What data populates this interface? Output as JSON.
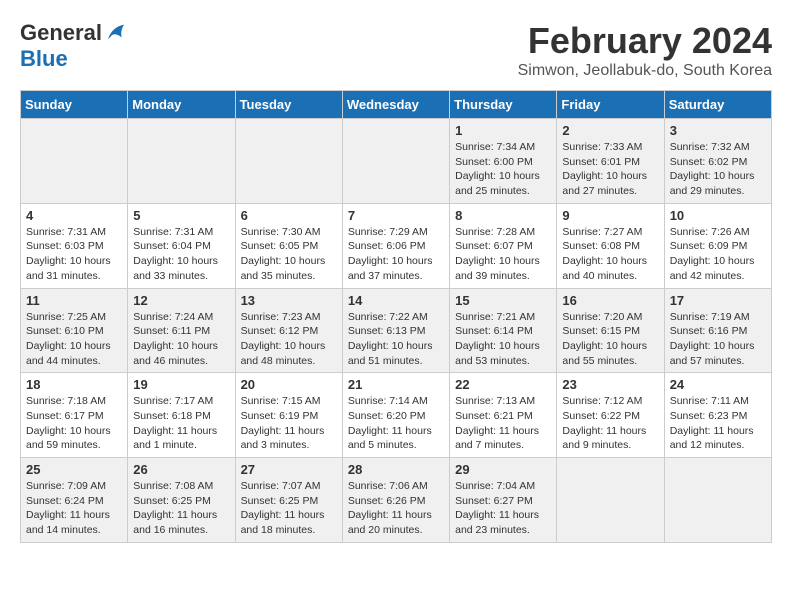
{
  "logo": {
    "general": "General",
    "blue": "Blue"
  },
  "title": "February 2024",
  "location": "Simwon, Jeollabuk-do, South Korea",
  "weekdays": [
    "Sunday",
    "Monday",
    "Tuesday",
    "Wednesday",
    "Thursday",
    "Friday",
    "Saturday"
  ],
  "weeks": [
    [
      {
        "day": "",
        "info": ""
      },
      {
        "day": "",
        "info": ""
      },
      {
        "day": "",
        "info": ""
      },
      {
        "day": "",
        "info": ""
      },
      {
        "day": "1",
        "info": "Sunrise: 7:34 AM\nSunset: 6:00 PM\nDaylight: 10 hours\nand 25 minutes."
      },
      {
        "day": "2",
        "info": "Sunrise: 7:33 AM\nSunset: 6:01 PM\nDaylight: 10 hours\nand 27 minutes."
      },
      {
        "day": "3",
        "info": "Sunrise: 7:32 AM\nSunset: 6:02 PM\nDaylight: 10 hours\nand 29 minutes."
      }
    ],
    [
      {
        "day": "4",
        "info": "Sunrise: 7:31 AM\nSunset: 6:03 PM\nDaylight: 10 hours\nand 31 minutes."
      },
      {
        "day": "5",
        "info": "Sunrise: 7:31 AM\nSunset: 6:04 PM\nDaylight: 10 hours\nand 33 minutes."
      },
      {
        "day": "6",
        "info": "Sunrise: 7:30 AM\nSunset: 6:05 PM\nDaylight: 10 hours\nand 35 minutes."
      },
      {
        "day": "7",
        "info": "Sunrise: 7:29 AM\nSunset: 6:06 PM\nDaylight: 10 hours\nand 37 minutes."
      },
      {
        "day": "8",
        "info": "Sunrise: 7:28 AM\nSunset: 6:07 PM\nDaylight: 10 hours\nand 39 minutes."
      },
      {
        "day": "9",
        "info": "Sunrise: 7:27 AM\nSunset: 6:08 PM\nDaylight: 10 hours\nand 40 minutes."
      },
      {
        "day": "10",
        "info": "Sunrise: 7:26 AM\nSunset: 6:09 PM\nDaylight: 10 hours\nand 42 minutes."
      }
    ],
    [
      {
        "day": "11",
        "info": "Sunrise: 7:25 AM\nSunset: 6:10 PM\nDaylight: 10 hours\nand 44 minutes."
      },
      {
        "day": "12",
        "info": "Sunrise: 7:24 AM\nSunset: 6:11 PM\nDaylight: 10 hours\nand 46 minutes."
      },
      {
        "day": "13",
        "info": "Sunrise: 7:23 AM\nSunset: 6:12 PM\nDaylight: 10 hours\nand 48 minutes."
      },
      {
        "day": "14",
        "info": "Sunrise: 7:22 AM\nSunset: 6:13 PM\nDaylight: 10 hours\nand 51 minutes."
      },
      {
        "day": "15",
        "info": "Sunrise: 7:21 AM\nSunset: 6:14 PM\nDaylight: 10 hours\nand 53 minutes."
      },
      {
        "day": "16",
        "info": "Sunrise: 7:20 AM\nSunset: 6:15 PM\nDaylight: 10 hours\nand 55 minutes."
      },
      {
        "day": "17",
        "info": "Sunrise: 7:19 AM\nSunset: 6:16 PM\nDaylight: 10 hours\nand 57 minutes."
      }
    ],
    [
      {
        "day": "18",
        "info": "Sunrise: 7:18 AM\nSunset: 6:17 PM\nDaylight: 10 hours\nand 59 minutes."
      },
      {
        "day": "19",
        "info": "Sunrise: 7:17 AM\nSunset: 6:18 PM\nDaylight: 11 hours\nand 1 minute."
      },
      {
        "day": "20",
        "info": "Sunrise: 7:15 AM\nSunset: 6:19 PM\nDaylight: 11 hours\nand 3 minutes."
      },
      {
        "day": "21",
        "info": "Sunrise: 7:14 AM\nSunset: 6:20 PM\nDaylight: 11 hours\nand 5 minutes."
      },
      {
        "day": "22",
        "info": "Sunrise: 7:13 AM\nSunset: 6:21 PM\nDaylight: 11 hours\nand 7 minutes."
      },
      {
        "day": "23",
        "info": "Sunrise: 7:12 AM\nSunset: 6:22 PM\nDaylight: 11 hours\nand 9 minutes."
      },
      {
        "day": "24",
        "info": "Sunrise: 7:11 AM\nSunset: 6:23 PM\nDaylight: 11 hours\nand 12 minutes."
      }
    ],
    [
      {
        "day": "25",
        "info": "Sunrise: 7:09 AM\nSunset: 6:24 PM\nDaylight: 11 hours\nand 14 minutes."
      },
      {
        "day": "26",
        "info": "Sunrise: 7:08 AM\nSunset: 6:25 PM\nDaylight: 11 hours\nand 16 minutes."
      },
      {
        "day": "27",
        "info": "Sunrise: 7:07 AM\nSunset: 6:25 PM\nDaylight: 11 hours\nand 18 minutes."
      },
      {
        "day": "28",
        "info": "Sunrise: 7:06 AM\nSunset: 6:26 PM\nDaylight: 11 hours\nand 20 minutes."
      },
      {
        "day": "29",
        "info": "Sunrise: 7:04 AM\nSunset: 6:27 PM\nDaylight: 11 hours\nand 23 minutes."
      },
      {
        "day": "",
        "info": ""
      },
      {
        "day": "",
        "info": ""
      }
    ]
  ]
}
